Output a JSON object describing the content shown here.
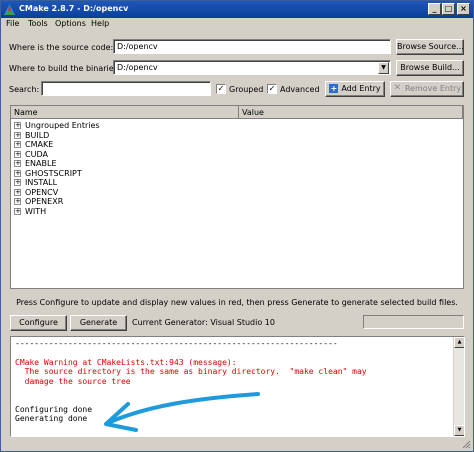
{
  "window": {
    "title": "CMake 2.8.7 - D:/opencv",
    "controls": {
      "minimize": "_",
      "maximize": "□",
      "close": "×"
    }
  },
  "menu": [
    {
      "label": "File"
    },
    {
      "label": "Tools"
    },
    {
      "label": "Options"
    },
    {
      "label": "Help"
    }
  ],
  "source": {
    "label": "Where is the source code:",
    "value": "D:/opencv",
    "browse_label": "Browse Source..."
  },
  "build": {
    "label": "Where to build the binaries:",
    "value": "D:/opencv",
    "browse_label": "Browse Build..."
  },
  "search": {
    "label": "Search:",
    "value": ""
  },
  "options": {
    "grouped": {
      "label": "Grouped",
      "checked": true
    },
    "advanced": {
      "label": "Advanced",
      "checked": true
    },
    "add_entry": "Add Entry",
    "remove_entry": "Remove Entry"
  },
  "table": {
    "columns": [
      "Name",
      "Value"
    ],
    "rows": [
      "Ungrouped Entries",
      "BUILD",
      "CMAKE",
      "CUDA",
      "ENABLE",
      "GHOSTSCRIPT",
      "INSTALL",
      "OPENCV",
      "OPENEXR",
      "WITH"
    ]
  },
  "status_message": "Press Configure to update and display new values in red, then press Generate to generate selected build files.",
  "actions": {
    "configure": "Configure",
    "generate": "Generate",
    "generator": "Current Generator: Visual Studio 10"
  },
  "output": {
    "lines": [
      {
        "text": "-------------------------------------------------------------------",
        "color": "#000000"
      },
      {
        "text": "",
        "color": "#000000"
      },
      {
        "text": "CMake Warning at CMakeLists.txt:943 (message):",
        "color": "#e00000"
      },
      {
        "text": "  The source directory is the same as binary directory.  \"make clean\" may",
        "color": "#e00000"
      },
      {
        "text": "  damage the source tree",
        "color": "#e00000"
      },
      {
        "text": "",
        "color": "#000000"
      },
      {
        "text": "",
        "color": "#000000"
      },
      {
        "text": "Configuring done",
        "color": "#000000"
      },
      {
        "text": "Generating done",
        "color": "#000000"
      }
    ]
  },
  "colors": {
    "title_bar": "#0a3e9c",
    "warning_text": "#e00000",
    "annotation_arrow": "#1e9bdc"
  }
}
